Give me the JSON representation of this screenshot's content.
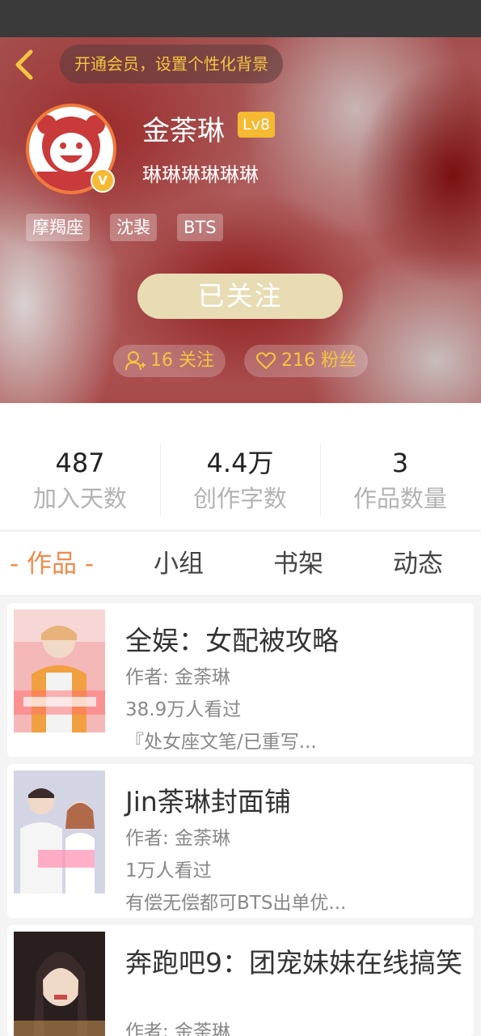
{
  "header": {
    "vip_prompt": "开通会员，设置个性化背景",
    "username": "金荼琳",
    "level": "Lv8",
    "verified_badge": "V",
    "signature": "琳琳琳琳琳琳",
    "tags": [
      "摩羯座",
      "沈裴",
      "BTS"
    ],
    "follow_button": "已关注",
    "following_count": "16 关注",
    "fans_count": "216 粉丝",
    "accent_color": "#f5c542",
    "icons": [
      "back-arrow-icon",
      "person-icon",
      "heart-icon"
    ]
  },
  "stats": [
    {
      "value": "487",
      "label": "加入天数"
    },
    {
      "value": "4.4万",
      "label": "创作字数"
    },
    {
      "value": "3",
      "label": "作品数量"
    }
  ],
  "tabs": {
    "active": "- 作品 -",
    "items": [
      "小组",
      "书架",
      "动态"
    ],
    "active_color": "#f08a4b"
  },
  "works": [
    {
      "title": "全娱：女配被攻略",
      "author": "作者: 金荼琳",
      "views": "38.9万人看过",
      "desc": "『处女座文笔/已重写..."
    },
    {
      "title": "Jin荼琳封面铺",
      "author": "作者: 金荼琳",
      "views": "1万人看过",
      "desc": "有偿无偿都可BTS出单优..."
    },
    {
      "title": "奔跑吧9：团宠妹妹在线搞笑",
      "author": "作者: 金荼琳"
    }
  ]
}
